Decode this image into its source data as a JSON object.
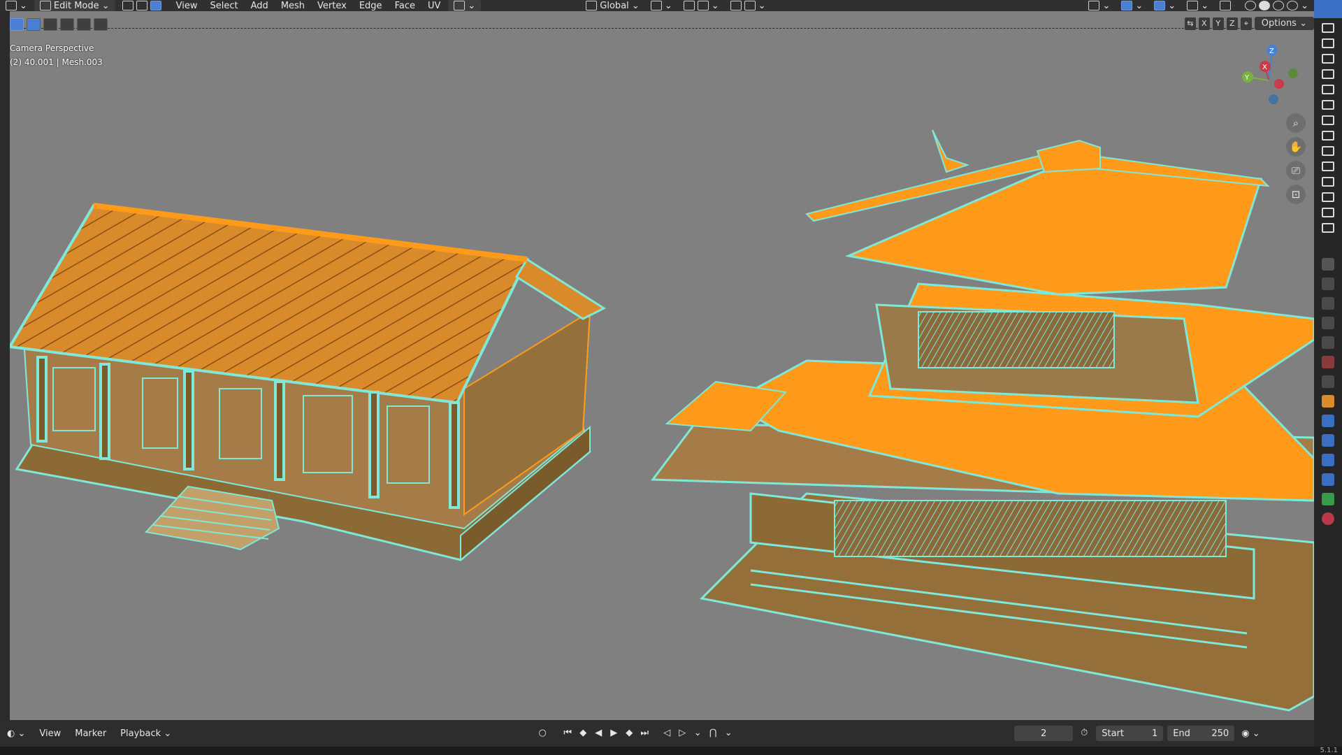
{
  "header": {
    "mode_label": "Edit Mode",
    "menus": [
      "View",
      "Select",
      "Add",
      "Mesh",
      "Vertex",
      "Edge",
      "Face",
      "UV"
    ],
    "transform_orientation": "Global",
    "options_label": "Options",
    "axes": [
      "X",
      "Y",
      "Z"
    ]
  },
  "viewport": {
    "camera_label": "Camera Perspective",
    "object_info": "(2) 40.001 | Mesh.003",
    "gizmo_labels": {
      "x": "X",
      "y": "Y",
      "z": "Z"
    },
    "colors": {
      "background": "#808080",
      "selection_orange": "#ff9a1a",
      "wire_cyan": "#7fe8d8"
    }
  },
  "timeline": {
    "menus": [
      "View",
      "Marker",
      "Playback"
    ],
    "current_frame": "2",
    "start_label": "Start",
    "start_value": "1",
    "end_label": "End",
    "end_value": "250"
  },
  "footer": {
    "version": "5.1.1"
  }
}
